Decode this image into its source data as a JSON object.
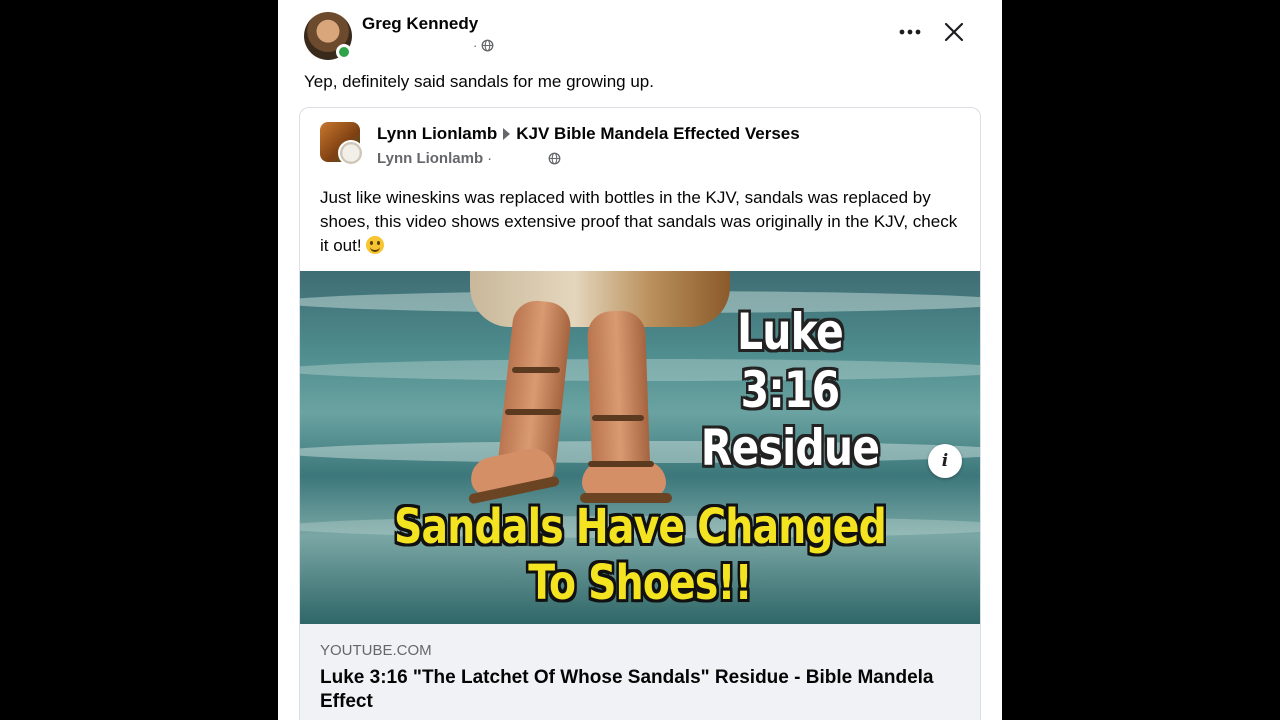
{
  "post": {
    "author": "Greg Kennedy",
    "meta_separator": "·",
    "text": "Yep, definitely said sandals for me growing up.",
    "more_icon": "more-horizontal-icon",
    "close_icon": "close-icon",
    "privacy_icon": "globe-icon"
  },
  "shared": {
    "author": "Lynn Lionlamb",
    "group": "KJV Bible Mandela Effected Verses",
    "sub_author": "Lynn Lionlamb",
    "sub_separator": "·",
    "body": "Just like wineskins was replaced with bottles in the KJV, sandals was replaced by shoes, this video shows extensive proof that sandals was originally in the KJV, check it out!",
    "thumbnail": {
      "title": "Luke 3:16\nResidue",
      "caption": "Sandals Have Changed\nTo Shoes!!"
    },
    "info_label": "i",
    "link": {
      "domain": "YOUTUBE.COM",
      "title": "Luke 3:16 \"The Latchet Of Whose Sandals\" Residue - Bible Mandela Effect"
    }
  },
  "colors": {
    "online": "#31a24c",
    "secondary_text": "#65676b",
    "thumb_caption": "#f3e321"
  }
}
